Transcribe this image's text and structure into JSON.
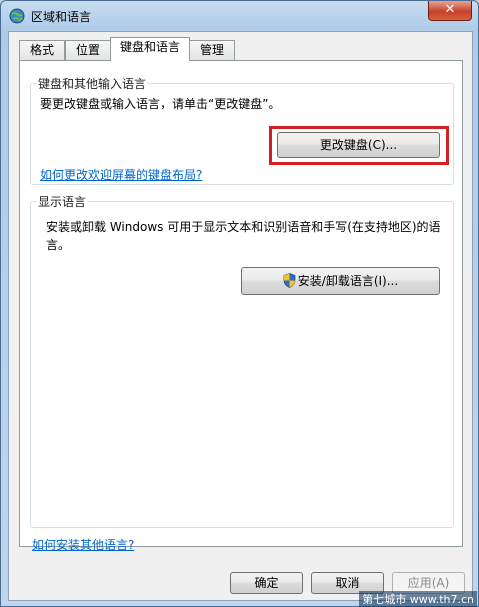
{
  "window": {
    "title": "区域和语言",
    "close_glyph": "✕"
  },
  "tabs": [
    {
      "label": "格式",
      "active": false
    },
    {
      "label": "位置",
      "active": false
    },
    {
      "label": "键盘和语言",
      "active": true
    },
    {
      "label": "管理",
      "active": false
    }
  ],
  "keyboard_group": {
    "title": "键盘和其他输入语言",
    "description": "要更改键盘或输入语言，请单击“更改键盘”。",
    "change_button": "更改键盘(C)...",
    "welcome_link": "如何更改欢迎屏幕的键盘布局?"
  },
  "display_group": {
    "title": "显示语言",
    "description": "安装或卸载 Windows 可用于显示文本和识别语音和手写(在支持地区)的语言。",
    "install_button": "安装/卸载语言(I)..."
  },
  "bottom_link": "如何安装其他语言?",
  "buttons": {
    "ok": "确定",
    "cancel": "取消",
    "apply": "应用(A)"
  },
  "watermark": "第七城市 www.th7.cn",
  "colors": {
    "highlight": "#d42020",
    "link": "#0066cc",
    "close": "#c7412a"
  }
}
